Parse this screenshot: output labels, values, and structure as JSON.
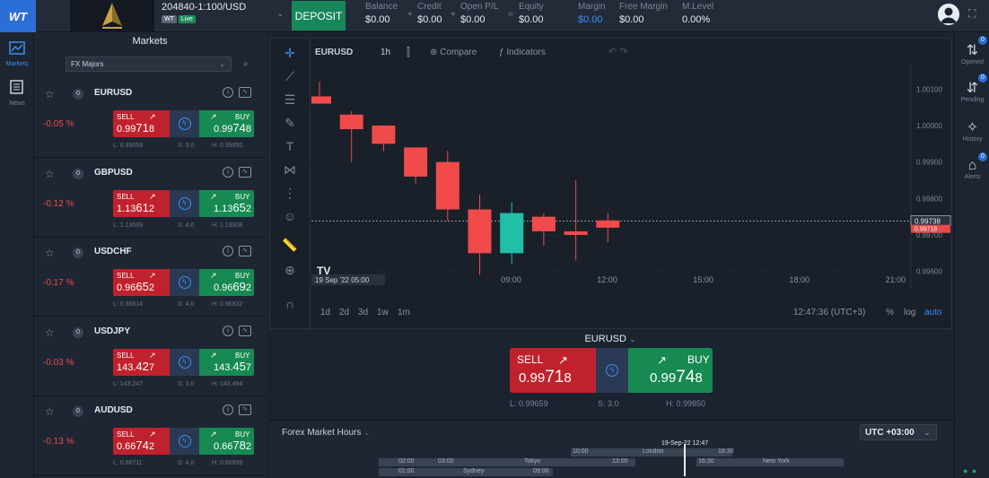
{
  "topbar": {
    "logo_text": "WT",
    "account_number": "204840-1:100/USD",
    "account_tag": "WT",
    "account_status": "Live",
    "deposit_label": "DEPOSIT",
    "stats": [
      {
        "label": "Balance",
        "value": "$0.00",
        "op": "+"
      },
      {
        "label": "Credit",
        "value": "$0.00",
        "op": "+"
      },
      {
        "label": "Open P/L",
        "value": "$0.00",
        "op": "="
      },
      {
        "label": "Equity",
        "value": "$0.00",
        "op": ""
      },
      {
        "label": "Margin",
        "value": "$0.00",
        "op": ""
      },
      {
        "label": "Free Margin",
        "value": "$0.00",
        "op": ""
      },
      {
        "label": "M.Level",
        "value": "0.00%",
        "op": ""
      }
    ]
  },
  "left_rail": {
    "markets_label": "Markets",
    "news_label": "News"
  },
  "markets": {
    "title": "Markets",
    "filter_value": "FX Majors",
    "instruments": [
      {
        "star": "☆",
        "count": "0",
        "symbol": "EURUSD",
        "change": "-0.05 %",
        "sell_label": "SELL",
        "buy_label": "BUY",
        "sell_pre": "0.99",
        "sell_big": "71",
        "sell_post": "8",
        "buy_pre": "0.99",
        "buy_big": "74",
        "buy_post": "8",
        "low": "L: 0.99659",
        "spread": "S: 3.0",
        "high": "H: 0.99850"
      },
      {
        "star": "☆",
        "count": "0",
        "symbol": "GBPUSD",
        "change": "-0.12 %",
        "sell_label": "SELL",
        "buy_label": "BUY",
        "sell_pre": "1.13",
        "sell_big": "61",
        "sell_post": "2",
        "buy_pre": "1.13",
        "buy_big": "65",
        "buy_post": "2",
        "low": "L: 1.13589",
        "spread": "S: 4.0",
        "high": "H: 1.13908"
      },
      {
        "star": "☆",
        "count": "0",
        "symbol": "USDCHF",
        "change": "-0.17 %",
        "sell_label": "SELL",
        "buy_label": "BUY",
        "sell_pre": "0.96",
        "sell_big": "65",
        "sell_post": "2",
        "buy_pre": "0.96",
        "buy_big": "69",
        "buy_post": "2",
        "low": "L: 0.96614",
        "spread": "S: 4.0",
        "high": "H: 0.96832"
      },
      {
        "star": "☆",
        "count": "0",
        "symbol": "USDJPY",
        "change": "-0.03 %",
        "sell_label": "SELL",
        "buy_label": "BUY",
        "sell_pre": "143.",
        "sell_big": "42",
        "sell_post": "7",
        "buy_pre": "143.",
        "buy_big": "45",
        "buy_post": "7",
        "low": "L: 143.247",
        "spread": "S: 3.0",
        "high": "H: 143.494"
      },
      {
        "star": "☆",
        "count": "0",
        "symbol": "AUDUSD",
        "change": "-0.13 %",
        "sell_label": "SELL",
        "buy_label": "BUY",
        "sell_pre": "0.66",
        "sell_big": "74",
        "sell_post": "2",
        "buy_pre": "0.66",
        "buy_big": "78",
        "buy_post": "2",
        "low": "L: 0.66711",
        "spread": "S: 4.0",
        "high": "H: 0.66899"
      }
    ]
  },
  "chart": {
    "symbol": "EURUSD",
    "timeframe": "1h",
    "compare_label": "Compare",
    "indicators_label": "Indicators",
    "date_label": "19 Sep '22",
    "date_time": "05:00",
    "time_labels": [
      "09:00",
      "12:00",
      "15:00",
      "18:00",
      "21:00"
    ],
    "price_labels": [
      "1.00100",
      "1.00000",
      "0.99900",
      "0.99800",
      "0.99700",
      "0.99600"
    ],
    "current_price_label": "0.99738",
    "bid_price_label": "0.99718",
    "ranges": [
      "1d",
      "2d",
      "3d",
      "1w",
      "1m"
    ],
    "clock": "12:47:36 (UTC+3)",
    "pct_label": "%",
    "log_label": "log",
    "auto_label": "auto",
    "tv_logo": "TV",
    "candles": [
      {
        "t": "03:00",
        "o": 1.0008,
        "h": 1.0012,
        "l": 1.0006,
        "c": 1.0006,
        "dir": "down"
      },
      {
        "t": "04:00",
        "o": 1.0003,
        "h": 1.0004,
        "l": 0.999,
        "c": 0.9999,
        "dir": "down"
      },
      {
        "t": "05:00",
        "o": 1.0,
        "h": 1.0,
        "l": 0.9993,
        "c": 0.9995,
        "dir": "down"
      },
      {
        "t": "06:00",
        "o": 0.9994,
        "h": 0.9994,
        "l": 0.9984,
        "c": 0.9986,
        "dir": "down"
      },
      {
        "t": "07:00",
        "o": 0.999,
        "h": 0.9993,
        "l": 0.9974,
        "c": 0.9977,
        "dir": "down"
      },
      {
        "t": "08:00",
        "o": 0.9977,
        "h": 0.9981,
        "l": 0.9959,
        "c": 0.9965,
        "dir": "down"
      },
      {
        "t": "09:00",
        "o": 0.9965,
        "h": 0.9979,
        "l": 0.9962,
        "c": 0.9976,
        "dir": "up"
      },
      {
        "t": "10:00",
        "o": 0.9975,
        "h": 0.9976,
        "l": 0.9967,
        "c": 0.9971,
        "dir": "down"
      },
      {
        "t": "11:00",
        "o": 0.9971,
        "h": 0.9985,
        "l": 0.9963,
        "c": 0.997,
        "dir": "down"
      },
      {
        "t": "12:00",
        "o": 0.9974,
        "h": 0.9976,
        "l": 0.9968,
        "c": 0.9972,
        "dir": "down"
      }
    ]
  },
  "chart_data": {
    "type": "candlestick",
    "title": "EURUSD",
    "timeframe": "1h",
    "x": [
      "03:00",
      "04:00",
      "05:00",
      "06:00",
      "07:00",
      "08:00",
      "09:00",
      "10:00",
      "11:00",
      "12:00"
    ],
    "open": [
      1.0008,
      1.0003,
      1.0,
      0.9994,
      0.999,
      0.9977,
      0.9965,
      0.9975,
      0.9971,
      0.9974
    ],
    "high": [
      1.0012,
      1.0004,
      1.0,
      0.9994,
      0.9993,
      0.9981,
      0.9979,
      0.9976,
      0.9985,
      0.9976
    ],
    "low": [
      1.0006,
      0.999,
      0.9993,
      0.9984,
      0.9974,
      0.9959,
      0.9962,
      0.9967,
      0.9963,
      0.9968
    ],
    "close": [
      1.0006,
      0.9999,
      0.9995,
      0.9986,
      0.9977,
      0.9965,
      0.9976,
      0.9971,
      0.997,
      0.9972
    ],
    "ylim": [
      0.9955,
      1.0015
    ],
    "y_ticks": [
      1.001,
      1.0,
      0.999,
      0.998,
      0.997,
      0.996
    ],
    "x_ticks": [
      "09:00",
      "12:00",
      "15:00",
      "18:00",
      "21:00"
    ],
    "current_price": 0.99738,
    "bid_price": 0.99718
  },
  "trade": {
    "symbol": "EURUSD",
    "sell_label": "SELL",
    "buy_label": "BUY",
    "sell_pre": "0.99",
    "sell_big": "71",
    "sell_post": "8",
    "buy_pre": "0.99",
    "buy_big": "74",
    "buy_post": "8",
    "low": "L: 0.99659",
    "spread": "S: 3.0",
    "high": "H: 0.99850"
  },
  "hours": {
    "title": "Forex Market Hours",
    "timezone": "UTC +03:00",
    "now_label": "19-Sep-22 12:47",
    "sessions": [
      {
        "name": "London",
        "open": "10:00",
        "close": "18:30"
      },
      {
        "name": "Tokyo",
        "open": "02:00",
        "close": "13:00",
        "mid": "03:00"
      },
      {
        "name": "New York",
        "open": "16:30",
        "close": ""
      },
      {
        "name": "Sydney",
        "open": "01:00",
        "close": "09:00"
      }
    ]
  },
  "right_rail": {
    "opened_label": "Opened",
    "pending_label": "Pending",
    "history_label": "History",
    "alerts_label": "Alerts",
    "opened_count": "0",
    "pending_count": "0",
    "alerts_count": "0"
  },
  "colors": {
    "sell": "#c0222d",
    "buy": "#178a52",
    "bear_candle": "#f04a4a",
    "bull_candle": "#1fbfa8",
    "accent": "#3b8ef0"
  }
}
